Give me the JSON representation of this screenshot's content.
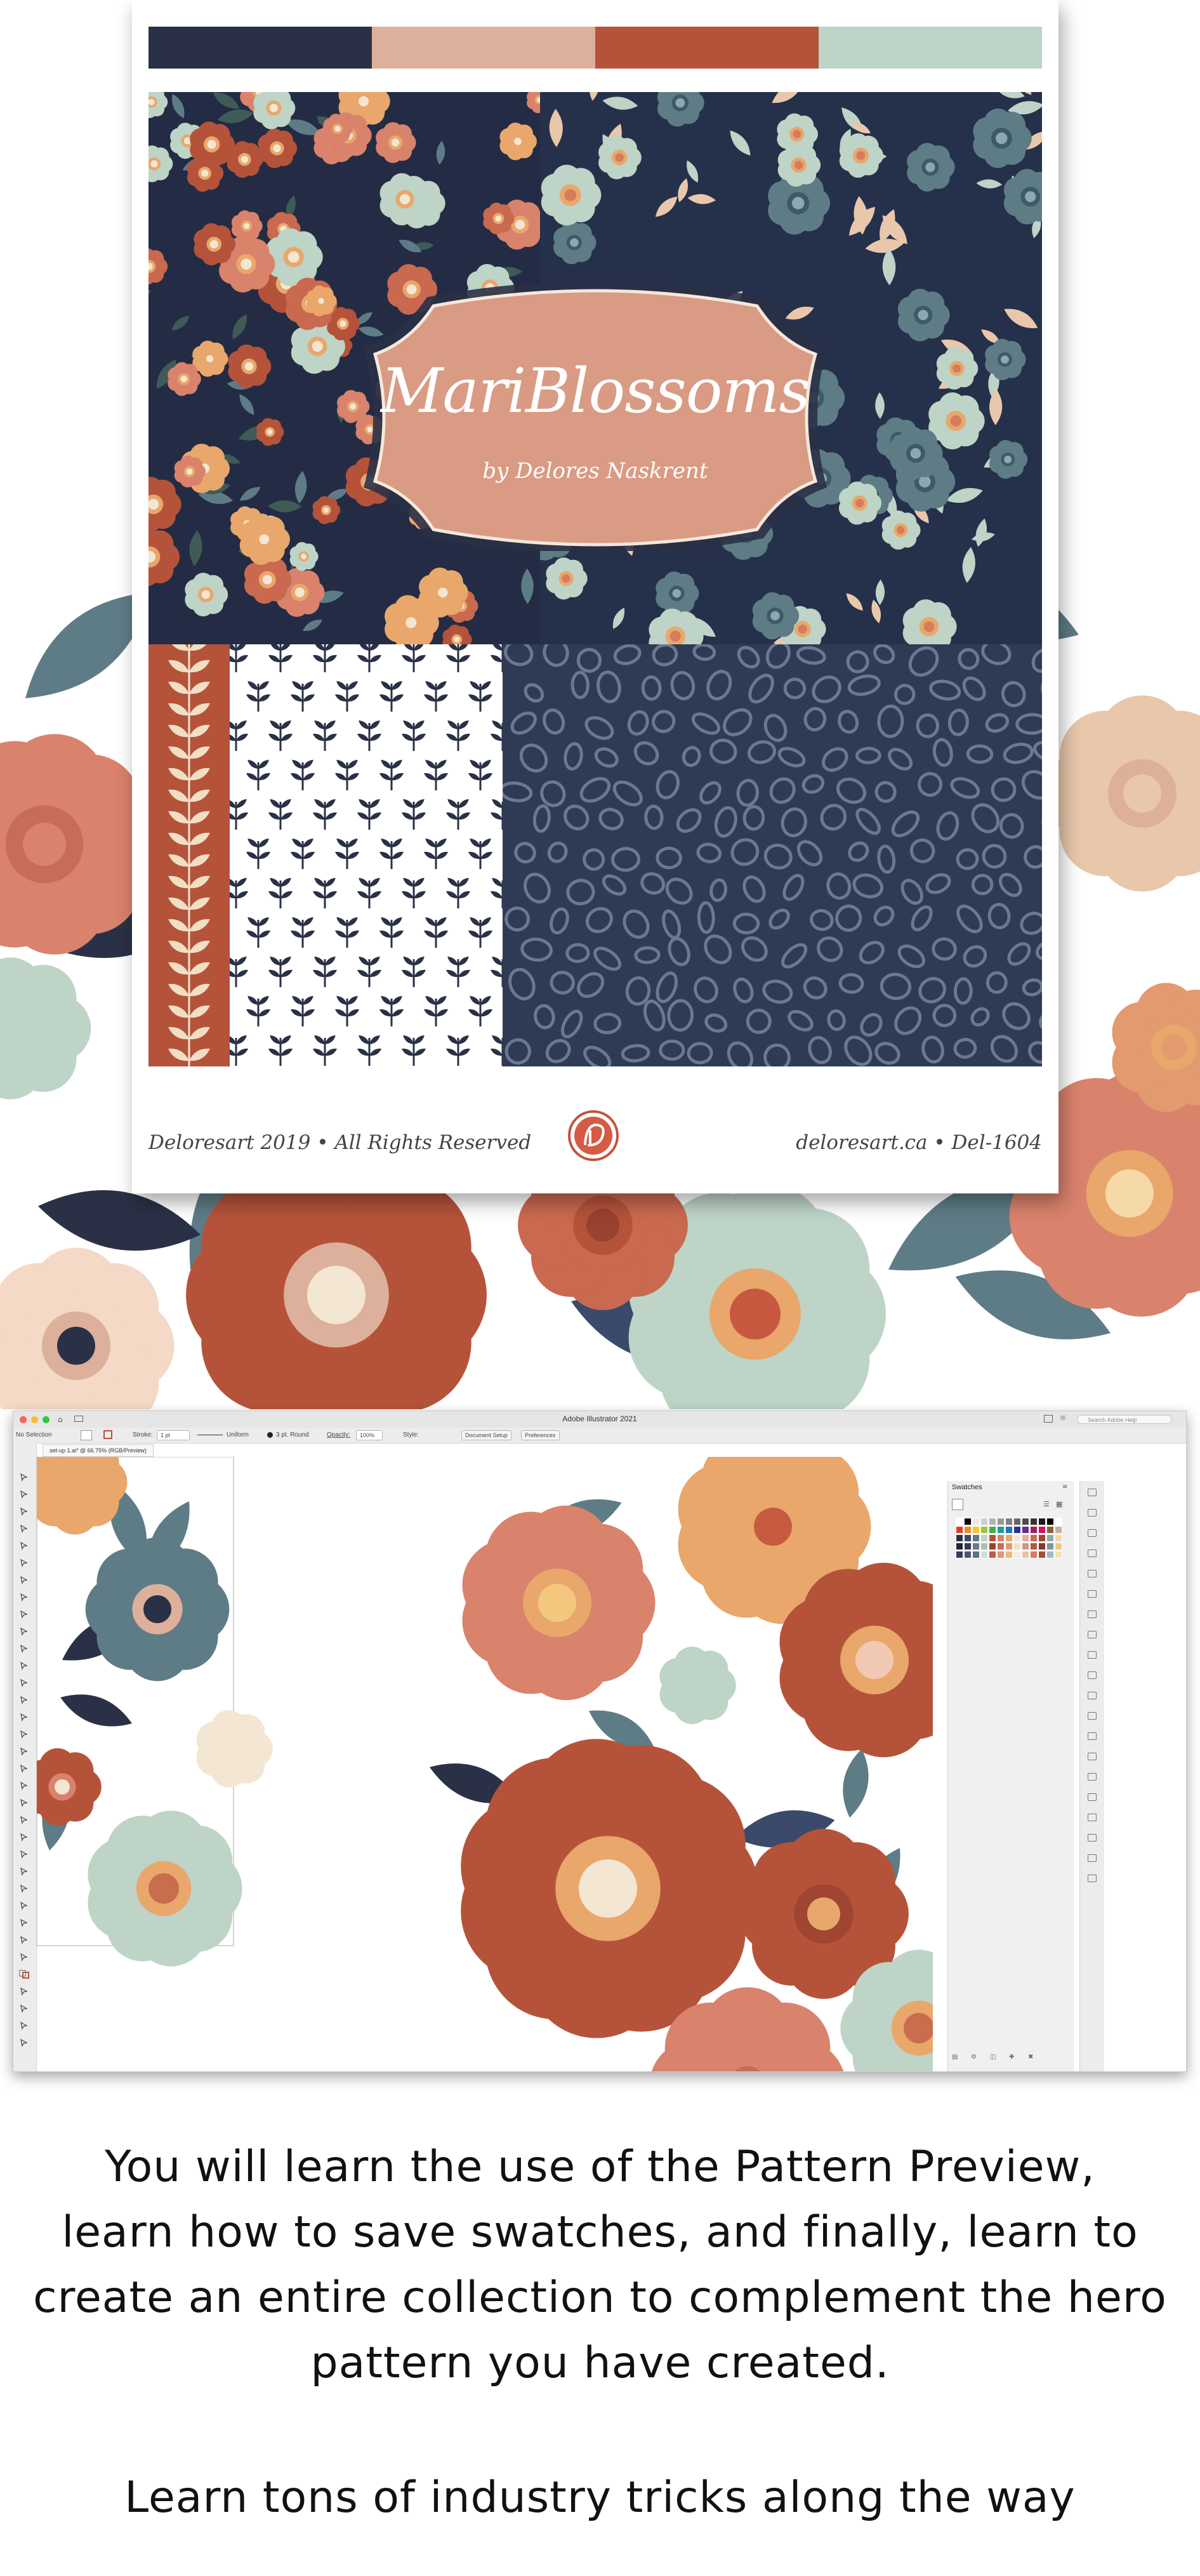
{
  "palette": {
    "navy": "#2a3146",
    "blush": "#ddb09b",
    "rust": "#b5533a",
    "sage": "#bdd4c6",
    "coral": "#d9826c",
    "tan": "#e9a76b",
    "slate": "#5e7c86",
    "cream": "#f3e6d3"
  },
  "collection": {
    "title": "MariBlossoms",
    "author": "by Delores Naskrent",
    "footer_left": "Deloresart 2019 • All Rights Reserved",
    "footer_right": "deloresart.ca • Del-1604",
    "logo_icon": "deloresart-logo-icon"
  },
  "illustrator": {
    "window_title": "Adobe Illustrator 2021",
    "search_placeholder": "Search Adobe Help",
    "selection_label": "No Selection",
    "stroke_label": "Stroke:",
    "stroke_value": "1 pt",
    "uniform_label": "Uniform",
    "brush_label": "3 pt. Round",
    "opacity_label": "Opacity:",
    "opacity_value": "100%",
    "style_label": "Style:",
    "document_setup_label": "Document Setup",
    "preferences_label": "Preferences",
    "document_tab": "set-up 1.ai* @ 66.75% (RGB/Preview)",
    "swatches_panel_title": "Swatches"
  },
  "description": {
    "line1": "You will learn the use of the Pattern Preview,",
    "line2": "learn how to save swatches, and finally, learn to",
    "line3": "create an entire collection to complement the hero",
    "line4": "pattern you have created.",
    "tagline": "Learn tons of industry tricks along the way"
  }
}
